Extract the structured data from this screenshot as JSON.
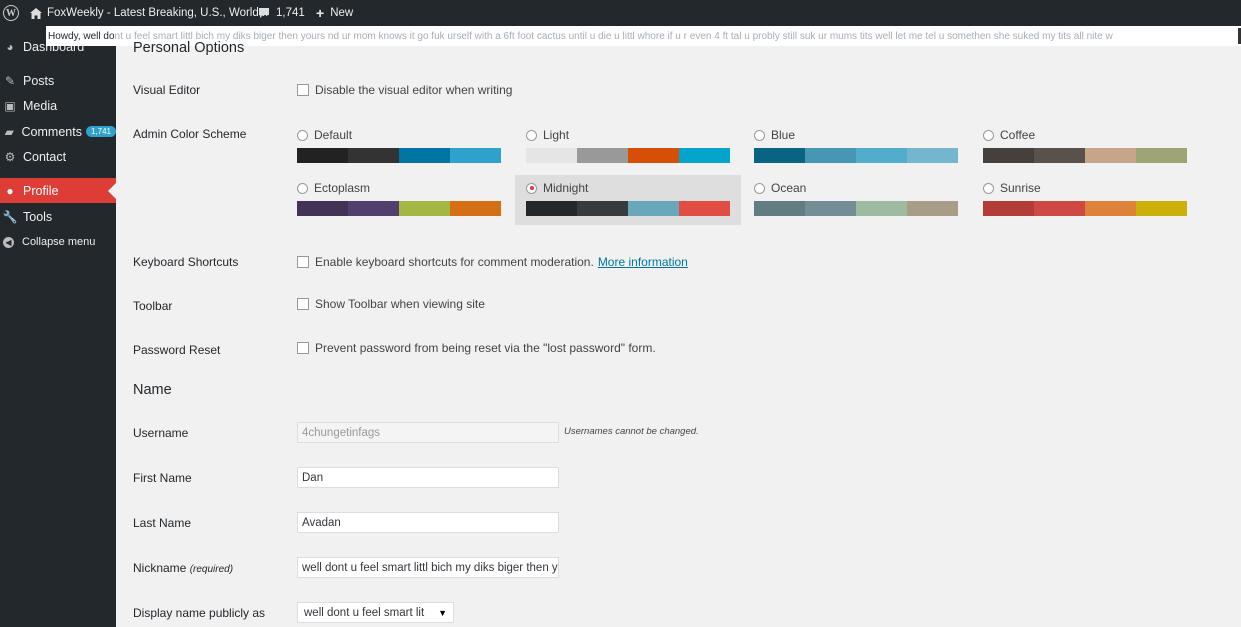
{
  "admin_bar": {
    "site_title": "FoxWeekly - Latest Breaking, U.S., World...",
    "comments_count": "1,741",
    "new_label": "New",
    "howdy_text": "Howdy, well do",
    "howdy_rest": "nt u feel smart littl bich my diks biger then yours nd ur mom knows it go fuk urself with a 6ft foot cactus until u die u littl whore if u r even 4 ft tal u probly still suk ur mums tits well let me tel u somethen she suked my tits all nite w"
  },
  "sidebar": {
    "items": [
      {
        "label": "Dashboard",
        "icon": "dashboard-icon"
      },
      {
        "label": "Posts",
        "icon": "pin-icon"
      },
      {
        "label": "Media",
        "icon": "media-icon"
      },
      {
        "label": "Comments",
        "icon": "comment-icon",
        "badge": "1,741"
      },
      {
        "label": "Contact",
        "icon": "gear-icon"
      },
      {
        "label": "Profile",
        "icon": "user-icon"
      },
      {
        "label": "Tools",
        "icon": "wrench-icon"
      },
      {
        "label": "Collapse menu",
        "icon": "collapse-icon"
      }
    ]
  },
  "personal_options": {
    "title": "Personal Options",
    "visual_editor": {
      "label": "Visual Editor",
      "checkbox_label": "Disable the visual editor when writing"
    },
    "color_scheme": {
      "label": "Admin Color Scheme",
      "selected": "Midnight",
      "schemes": [
        {
          "name": "Default",
          "colors": [
            "#222222",
            "#333333",
            "#0074a2",
            "#2ea2cc"
          ]
        },
        {
          "name": "Light",
          "colors": [
            "#e5e5e5",
            "#999999",
            "#d64e07",
            "#04a4cc"
          ]
        },
        {
          "name": "Blue",
          "colors": [
            "#096484",
            "#4796b3",
            "#52accc",
            "#74b6ce"
          ]
        },
        {
          "name": "Coffee",
          "colors": [
            "#46403c",
            "#59524c",
            "#c7a589",
            "#9ea476"
          ]
        },
        {
          "name": "Ectoplasm",
          "colors": [
            "#413256",
            "#523f6d",
            "#a3b745",
            "#d46f15"
          ]
        },
        {
          "name": "Midnight",
          "colors": [
            "#25282b",
            "#363b3f",
            "#69a8bb",
            "#e14d43"
          ]
        },
        {
          "name": "Ocean",
          "colors": [
            "#627c83",
            "#738e96",
            "#9ebaa0",
            "#aa9d88"
          ]
        },
        {
          "name": "Sunrise",
          "colors": [
            "#b43c38",
            "#cf4944",
            "#dd823b",
            "#ccaf0b"
          ]
        }
      ]
    },
    "keyboard_shortcuts": {
      "label": "Keyboard Shortcuts",
      "checkbox_label": "Enable keyboard shortcuts for comment moderation.",
      "link": "More information"
    },
    "toolbar": {
      "label": "Toolbar",
      "checkbox_label": "Show Toolbar when viewing site"
    },
    "password_reset": {
      "label": "Password Reset",
      "checkbox_label": "Prevent password from being reset via the \"lost password\" form."
    }
  },
  "name_section": {
    "title": "Name",
    "username": {
      "label": "Username",
      "value": "4chungetinfags",
      "description": "Usernames cannot be changed."
    },
    "first_name": {
      "label": "First Name",
      "value": "Dan"
    },
    "last_name": {
      "label": "Last Name",
      "value": "Avadan"
    },
    "nickname": {
      "label": "Nickname",
      "required": "(required)",
      "value": "well dont u feel smart littl bich my diks biger then yours"
    },
    "display_name": {
      "label": "Display name publicly as",
      "value": "well dont u feel smart lit"
    }
  }
}
